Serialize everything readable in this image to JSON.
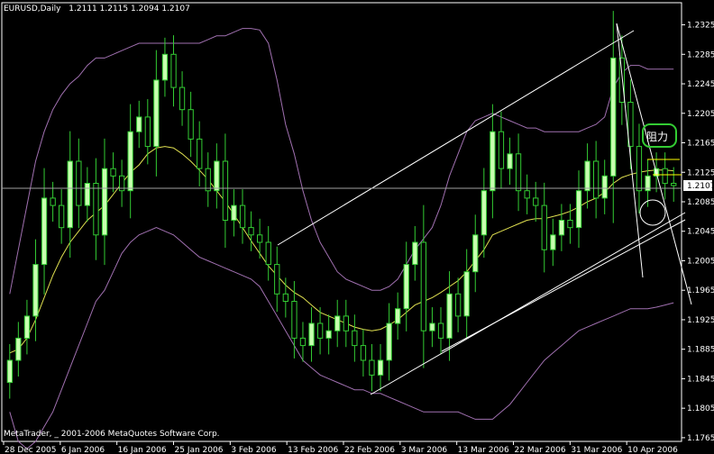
{
  "header": {
    "symbol": "EURUSD,Daily",
    "ohlc": "1.2111 1.2115 1.2094 1.2107"
  },
  "copyright": "MetaTrader, _ 2001-2006 MetaQuotes Software Corp.",
  "annotation": {
    "label": "阻力"
  },
  "colors": {
    "background": "#000000",
    "candle_up": "#c8ffb0",
    "candle_down": "#000000",
    "candle_wick": "#33cc33",
    "moving_average": "#e0e050",
    "bollinger": "#a070b0",
    "trendline": "#ffffff",
    "resistance": "#ffff00",
    "annotation": "#33cc33",
    "axis": "#ffffff"
  },
  "chart_data": {
    "type": "line",
    "ylim": [
      1.176,
      1.2355
    ],
    "yticks": [
      "1.2325",
      "1.2285",
      "1.2245",
      "1.2205",
      "1.2165",
      "1.2125",
      "1.2085",
      "1.2045",
      "1.2005",
      "1.1965",
      "1.1925",
      "1.1885",
      "1.1845",
      "1.1805",
      "1.1765"
    ],
    "xticks": [
      "28 Dec 2005",
      "6 Jan 2006",
      "16 Jan 2006",
      "25 Jan 2006",
      "3 Feb 2006",
      "13 Feb 2006",
      "22 Feb 2006",
      "3 Mar 2006",
      "13 Mar 2006",
      "22 Mar 2006",
      "31 Mar 2006",
      "10 Apr 2006"
    ],
    "last_price": "1.2107",
    "series": [
      {
        "kind": "candlestick",
        "close": [
          1.187,
          1.19,
          1.193,
          1.2,
          1.209,
          1.208,
          1.205,
          1.214,
          1.208,
          1.211,
          1.204,
          1.213,
          1.212,
          1.21,
          1.218,
          1.22,
          1.216,
          1.225,
          1.2285,
          1.224,
          1.221,
          1.217,
          1.213,
          1.21,
          1.214,
          1.206,
          1.208,
          1.205,
          1.204,
          1.203,
          1.2,
          1.196,
          1.195,
          1.19,
          1.189,
          1.192,
          1.19,
          1.191,
          1.193,
          1.191,
          1.189,
          1.187,
          1.185,
          1.187,
          1.192,
          1.194,
          1.2,
          1.203,
          1.191,
          1.192,
          1.19,
          1.196,
          1.193,
          1.199,
          1.204,
          1.21,
          1.218,
          1.213,
          1.215,
          1.21,
          1.209,
          1.208,
          1.202,
          1.204,
          1.206,
          1.205,
          1.21,
          1.214,
          1.209,
          1.212,
          1.228,
          1.222,
          1.216,
          1.21,
          1.212,
          1.213,
          1.211,
          1.2107
        ]
      },
      {
        "kind": "moving_average",
        "values": [
          1.188,
          1.1885,
          1.19,
          1.1925,
          1.1955,
          1.1985,
          1.201,
          1.203,
          1.2045,
          1.206,
          1.207,
          1.208,
          1.2095,
          1.211,
          1.2125,
          1.2135,
          1.215,
          1.2158,
          1.216,
          1.2158,
          1.215,
          1.214,
          1.2128,
          1.2115,
          1.21,
          1.2085,
          1.2068,
          1.205,
          1.2032,
          1.2015,
          1.1998,
          1.1985,
          1.1972,
          1.1962,
          1.1955,
          1.1945,
          1.1935,
          1.193,
          1.1925,
          1.192,
          1.1915,
          1.1912,
          1.191,
          1.1912,
          1.1918,
          1.1925,
          1.1935,
          1.1945,
          1.195,
          1.1955,
          1.1962,
          1.197,
          1.1978,
          1.199,
          1.2005,
          1.202,
          1.204,
          1.2045,
          1.205,
          1.2055,
          1.206,
          1.2062,
          1.2062,
          1.2065,
          1.2068,
          1.2072,
          1.2078,
          1.2085,
          1.209,
          1.2098,
          1.211,
          1.2118,
          1.2122,
          1.2125,
          1.2127,
          1.2128,
          1.2128,
          1.2127
        ]
      },
      {
        "kind": "bollinger_upper",
        "values": [
          1.196,
          1.202,
          1.208,
          1.214,
          1.218,
          1.221,
          1.223,
          1.2245,
          1.2255,
          1.227,
          1.228,
          1.228,
          1.2285,
          1.229,
          1.2295,
          1.23,
          1.23,
          1.23,
          1.23,
          1.23,
          1.23,
          1.23,
          1.23,
          1.2305,
          1.231,
          1.231,
          1.2315,
          1.232,
          1.232,
          1.2318,
          1.23,
          1.225,
          1.219,
          1.215,
          1.21,
          1.206,
          1.203,
          1.201,
          1.199,
          1.198,
          1.1975,
          1.197,
          1.1965,
          1.1965,
          1.197,
          1.198,
          1.2,
          1.202,
          1.2035,
          1.205,
          1.208,
          1.212,
          1.215,
          1.218,
          1.2195,
          1.22,
          1.2205,
          1.22,
          1.2195,
          1.219,
          1.2185,
          1.2185,
          1.218,
          1.218,
          1.218,
          1.218,
          1.218,
          1.2185,
          1.219,
          1.22,
          1.224,
          1.226,
          1.227,
          1.227,
          1.2265,
          1.2265,
          1.2265,
          1.2265
        ]
      },
      {
        "kind": "bollinger_lower",
        "values": [
          1.18,
          1.176,
          1.175,
          1.176,
          1.178,
          1.18,
          1.183,
          1.186,
          1.189,
          1.192,
          1.195,
          1.1965,
          1.199,
          1.2015,
          1.203,
          1.204,
          1.2045,
          1.205,
          1.2045,
          1.204,
          1.203,
          1.202,
          1.201,
          1.2005,
          1.2,
          1.1995,
          1.199,
          1.1985,
          1.198,
          1.197,
          1.195,
          1.193,
          1.191,
          1.189,
          1.187,
          1.186,
          1.185,
          1.1845,
          1.184,
          1.1835,
          1.183,
          1.183,
          1.1825,
          1.1825,
          1.182,
          1.1815,
          1.181,
          1.1805,
          1.18,
          1.18,
          1.18,
          1.18,
          1.18,
          1.1795,
          1.179,
          1.179,
          1.179,
          1.18,
          1.181,
          1.1825,
          1.184,
          1.1855,
          1.187,
          1.188,
          1.189,
          1.19,
          1.191,
          1.1915,
          1.192,
          1.1925,
          1.193,
          1.1935,
          1.194,
          1.194,
          1.194,
          1.1942,
          1.1945,
          1.1948
        ]
      }
    ]
  }
}
